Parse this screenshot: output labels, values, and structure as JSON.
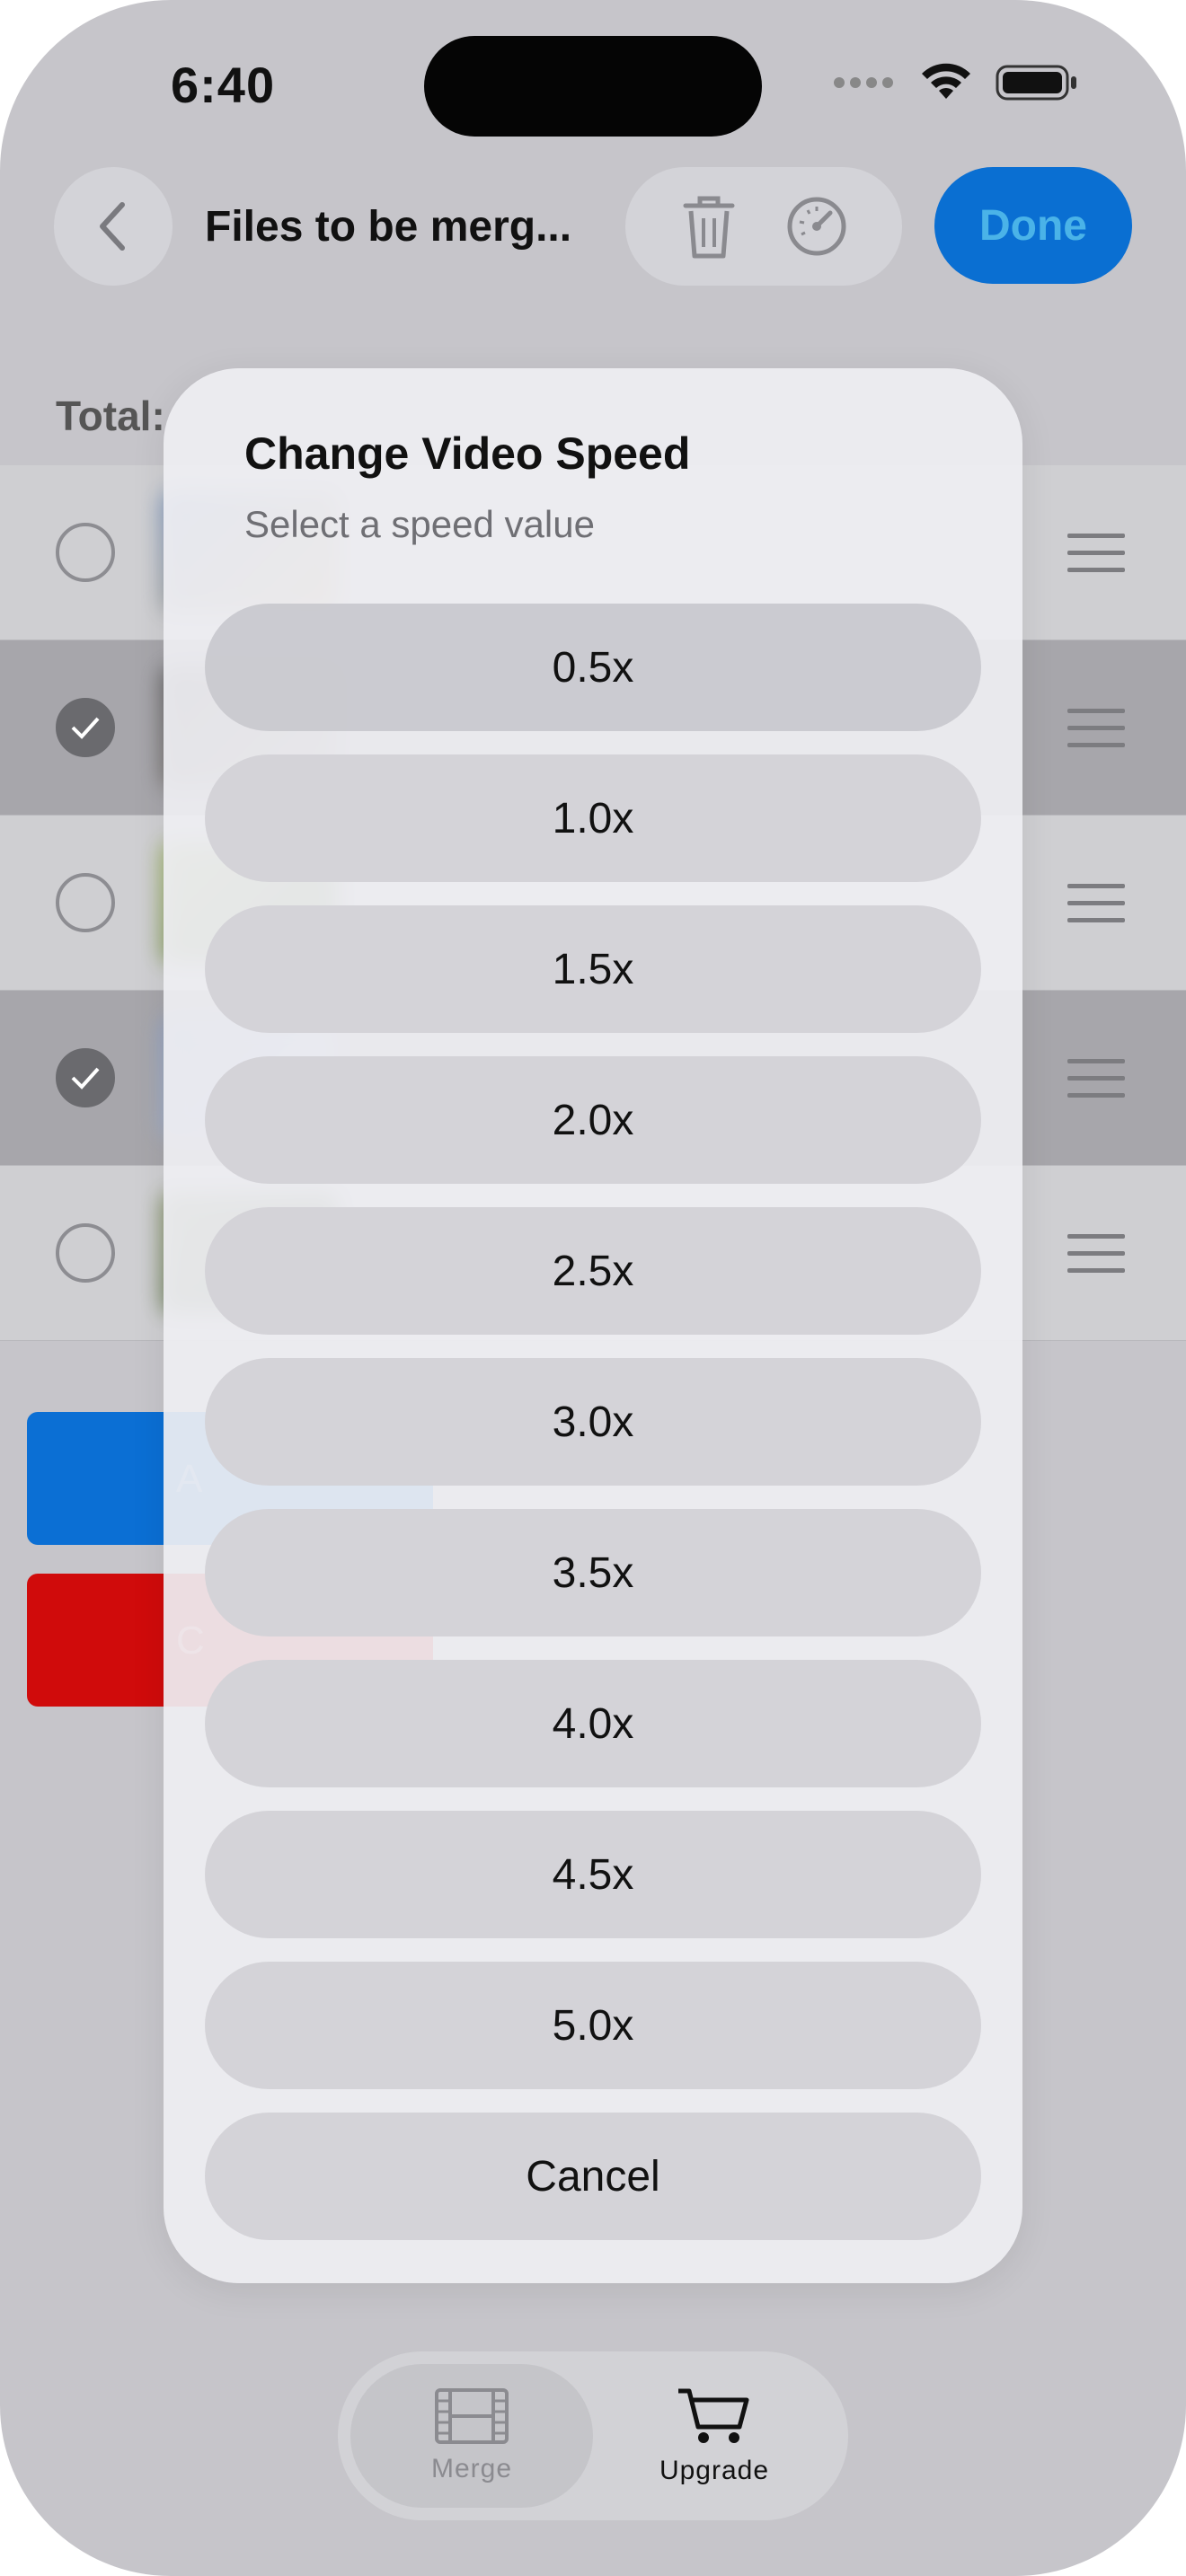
{
  "status_bar": {
    "time": "6:40"
  },
  "nav": {
    "title": "Files to be merg...",
    "done_label": "Done"
  },
  "list": {
    "total_label": "Total:",
    "rows": [
      {
        "checked": false
      },
      {
        "checked": true
      },
      {
        "checked": false
      },
      {
        "checked": true
      },
      {
        "checked": false
      }
    ]
  },
  "background_buttons": {
    "add_letter": "A",
    "clear_letter": "C"
  },
  "dialog": {
    "title": "Change Video Speed",
    "subtitle": "Select a speed value",
    "options": [
      "0.5x",
      "1.0x",
      "1.5x",
      "2.0x",
      "2.5x",
      "3.0x",
      "3.5x",
      "4.0x",
      "4.5x",
      "5.0x"
    ],
    "cancel_label": "Cancel"
  },
  "tab_bar": {
    "tabs": [
      {
        "label": "Merge"
      },
      {
        "label": "Upgrade"
      }
    ]
  },
  "colors": {
    "accent": "#0a6fd2",
    "destructive": "#d00b0b",
    "dim_background": "#c6c5ca"
  }
}
